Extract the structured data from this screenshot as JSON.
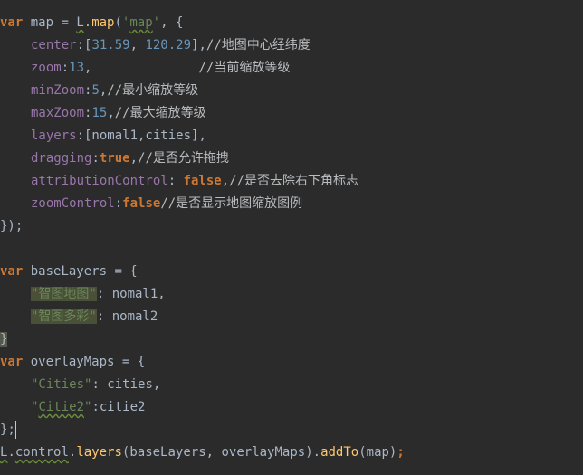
{
  "lines": {
    "l1": {
      "kw": "var",
      "name": " map = ",
      "L": "L",
      "dot": ".",
      "fn": "map",
      "p1": "(",
      "q1": "'",
      "str": "map",
      "q2": "'",
      "rest": ", {"
    },
    "l2": {
      "prop": "center",
      "colon": ":[",
      "n1": "31.59",
      "sep": ", ",
      "n2": "120.29",
      "close": "],",
      "com": "//地图中心经纬度"
    },
    "l3": {
      "prop": "zoom",
      "colon": ":",
      "num": "13",
      "comma": ",",
      "pad": "              ",
      "com": "//当前缩放等级"
    },
    "l4": {
      "prop": "minZoom",
      "colon": ":",
      "num": "5",
      "comma": ",",
      "com": "//最小缩放等级"
    },
    "l5": {
      "prop": "maxZoom",
      "colon": ":",
      "num": "15",
      "comma": ",",
      "com": "//最大缩放等级"
    },
    "l6": {
      "prop": "layers",
      "rest": ":[nomal1,cities],"
    },
    "l7": {
      "prop": "dragging",
      "colon": ":",
      "kw": "true",
      "comma": ",",
      "com": "//是否允许拖拽"
    },
    "l8": {
      "prop": "attributionControl",
      "colon": ": ",
      "kw": "false",
      "comma": ",",
      "com": "//是否去除右下角标志"
    },
    "l9": {
      "prop": "zoomControl",
      "colon": ":",
      "kw": "false",
      "com": "//是否显示地图缩放图例"
    },
    "l10": {
      "text": "});"
    },
    "l12": {
      "kw": "var",
      "rest": " baseLayers = {"
    },
    "l13": {
      "str": "\"智图地图\"",
      "rest": ": nomal1,"
    },
    "l14": {
      "str": "\"智图多彩\"",
      "rest": ": nomal2"
    },
    "l15": {
      "text": "}"
    },
    "l16": {
      "kw": "var",
      "rest": " overlayMaps = {"
    },
    "l17": {
      "str": "\"Cities\"",
      "rest": ": cities,"
    },
    "l18": {
      "q1": "\"",
      "str": "Citie2",
      "q2": "\"",
      "rest": ":citie2"
    },
    "l19": {
      "brace": "}",
      "semi": ";"
    },
    "l20": {
      "L": "L",
      "d1": ".",
      "control": "control",
      "d2": ".",
      "fn1": "layers",
      "args": "(baseLayers, overlayMaps).",
      "fn2": "addTo",
      "rest": "(map)",
      "semi": ";"
    }
  },
  "colors": {
    "background": "#2b2b2b",
    "keyword": "#cc7832",
    "property": "#9876aa",
    "number": "#6897bb",
    "string": "#6a8759",
    "text": "#a9b7c6",
    "function": "#ffc66d"
  }
}
